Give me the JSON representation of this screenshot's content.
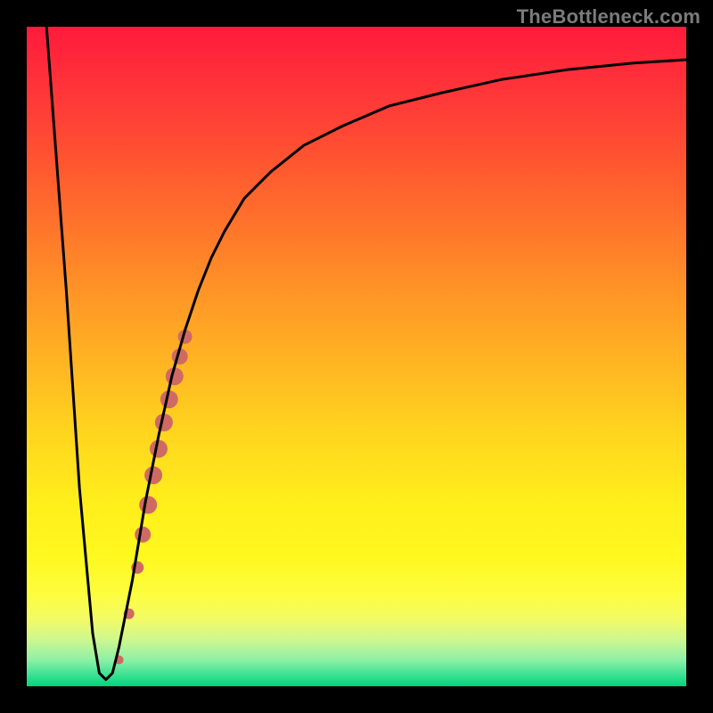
{
  "watermark": "TheBottleneck.com",
  "chart_data": {
    "type": "line",
    "title": "",
    "xlabel": "",
    "ylabel": "",
    "xlim": [
      0,
      100
    ],
    "ylim": [
      0,
      100
    ],
    "grid": false,
    "series": [
      {
        "name": "bottleneck-curve",
        "color": "#000000",
        "x": [
          3,
          6,
          8,
          10,
          11,
          12,
          13,
          14,
          16,
          18,
          20,
          22,
          24,
          26,
          28,
          30,
          33,
          37,
          42,
          48,
          55,
          63,
          72,
          82,
          92,
          100
        ],
        "y": [
          100,
          60,
          30,
          8,
          2,
          1,
          2,
          6,
          16,
          28,
          38,
          47,
          54,
          60,
          65,
          69,
          74,
          78,
          82,
          85,
          88,
          90,
          92,
          93.5,
          94.5,
          95
        ]
      }
    ],
    "markers": [
      {
        "name": "highlight-dots",
        "color": "#cf6a63",
        "points": [
          {
            "x": 14.0,
            "y": 4.0,
            "r": 5
          },
          {
            "x": 15.5,
            "y": 11.0,
            "r": 6
          },
          {
            "x": 16.8,
            "y": 18.0,
            "r": 7
          },
          {
            "x": 17.6,
            "y": 23.0,
            "r": 9
          },
          {
            "x": 18.4,
            "y": 27.5,
            "r": 10
          },
          {
            "x": 19.2,
            "y": 32.0,
            "r": 10
          },
          {
            "x": 20.0,
            "y": 36.0,
            "r": 10
          },
          {
            "x": 20.8,
            "y": 40.0,
            "r": 10
          },
          {
            "x": 21.6,
            "y": 43.5,
            "r": 10
          },
          {
            "x": 22.4,
            "y": 47.0,
            "r": 10
          },
          {
            "x": 23.2,
            "y": 50.0,
            "r": 9
          },
          {
            "x": 24.0,
            "y": 53.0,
            "r": 8
          }
        ]
      }
    ]
  }
}
